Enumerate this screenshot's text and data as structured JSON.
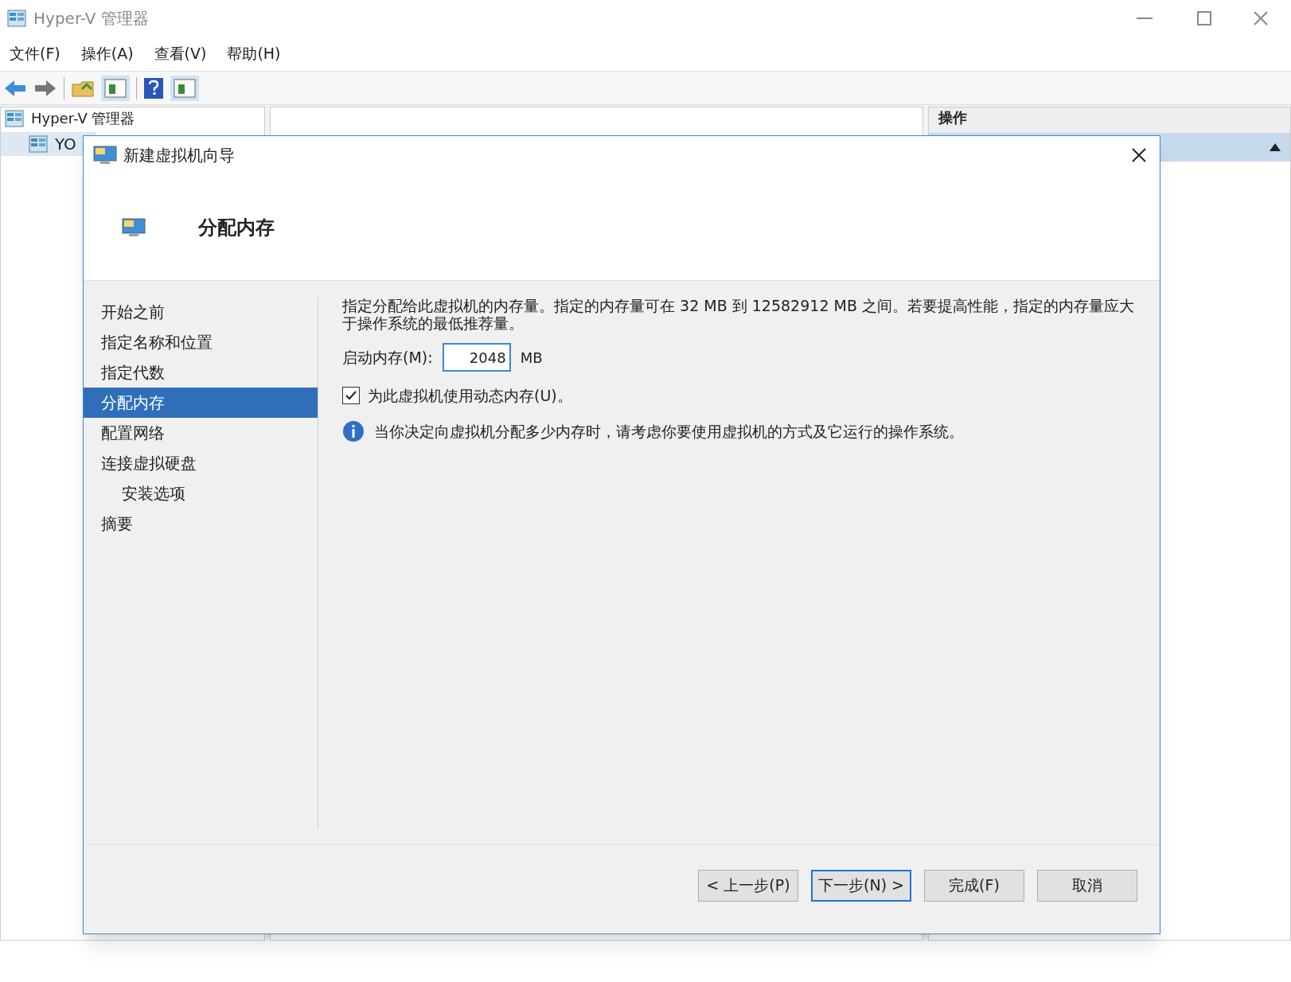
{
  "window": {
    "title": "Hyper-V 管理器"
  },
  "menu": [
    "文件(F)",
    "操作(A)",
    "查看(V)",
    "帮助(H)"
  ],
  "tree": [
    {
      "label": "Hyper-V 管理器",
      "children": [
        {
          "label": "YO"
        }
      ]
    }
  ],
  "actions_pane": {
    "title": "操作"
  },
  "dialog": {
    "title": "新建虚拟机向导",
    "heading": "分配内存",
    "steps": [
      {
        "label": "开始之前",
        "selected": false
      },
      {
        "label": "指定名称和位置",
        "selected": false
      },
      {
        "label": "指定代数",
        "selected": false
      },
      {
        "label": "分配内存",
        "selected": true
      },
      {
        "label": "配置网络",
        "selected": false
      },
      {
        "label": "连接虚拟硬盘",
        "selected": false,
        "children": [
          {
            "label": "安装选项",
            "selected": false
          }
        ]
      },
      {
        "label": "摘要",
        "selected": false
      }
    ],
    "description": "指定分配给此虚拟机的内存量。指定的内存量可在 32 MB 到 12582912 MB 之间。若要提高性能，指定的内存量应大于操作系统的最低推荐量。",
    "startup_memory": {
      "label": "启动内存(M):",
      "value": "2048",
      "unit": "MB"
    },
    "dynamic_memory": {
      "label": "为此虚拟机使用动态内存(U)。",
      "checked": true
    },
    "info": "当你决定向虚拟机分配多少内存时，请考虑你要使用虚拟机的方式及它运行的操作系统。",
    "buttons": [
      {
        "label": "< 上一步(P)",
        "default": false
      },
      {
        "label": "下一步(N) >",
        "default": true
      },
      {
        "label": "完成(F)",
        "default": false
      },
      {
        "label": "取消",
        "default": false
      }
    ]
  }
}
